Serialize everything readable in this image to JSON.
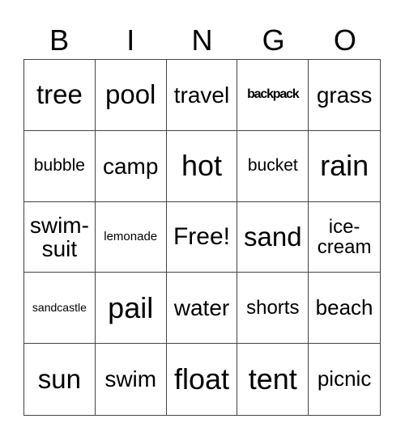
{
  "header": {
    "letters": [
      "B",
      "I",
      "N",
      "G",
      "O"
    ]
  },
  "card": {
    "rows": [
      [
        "tree",
        "pool",
        "travel",
        "backpack",
        "grass"
      ],
      [
        "bubble",
        "camp",
        "hot",
        "bucket",
        "rain"
      ],
      [
        "swim-\nsuit",
        "lemonade",
        "Free!",
        "sand",
        "ice-\ncream"
      ],
      [
        "sandcastle",
        "pail",
        "water",
        "shorts",
        "beach"
      ],
      [
        "sun",
        "swim",
        "float",
        "tent",
        "picnic"
      ]
    ]
  }
}
